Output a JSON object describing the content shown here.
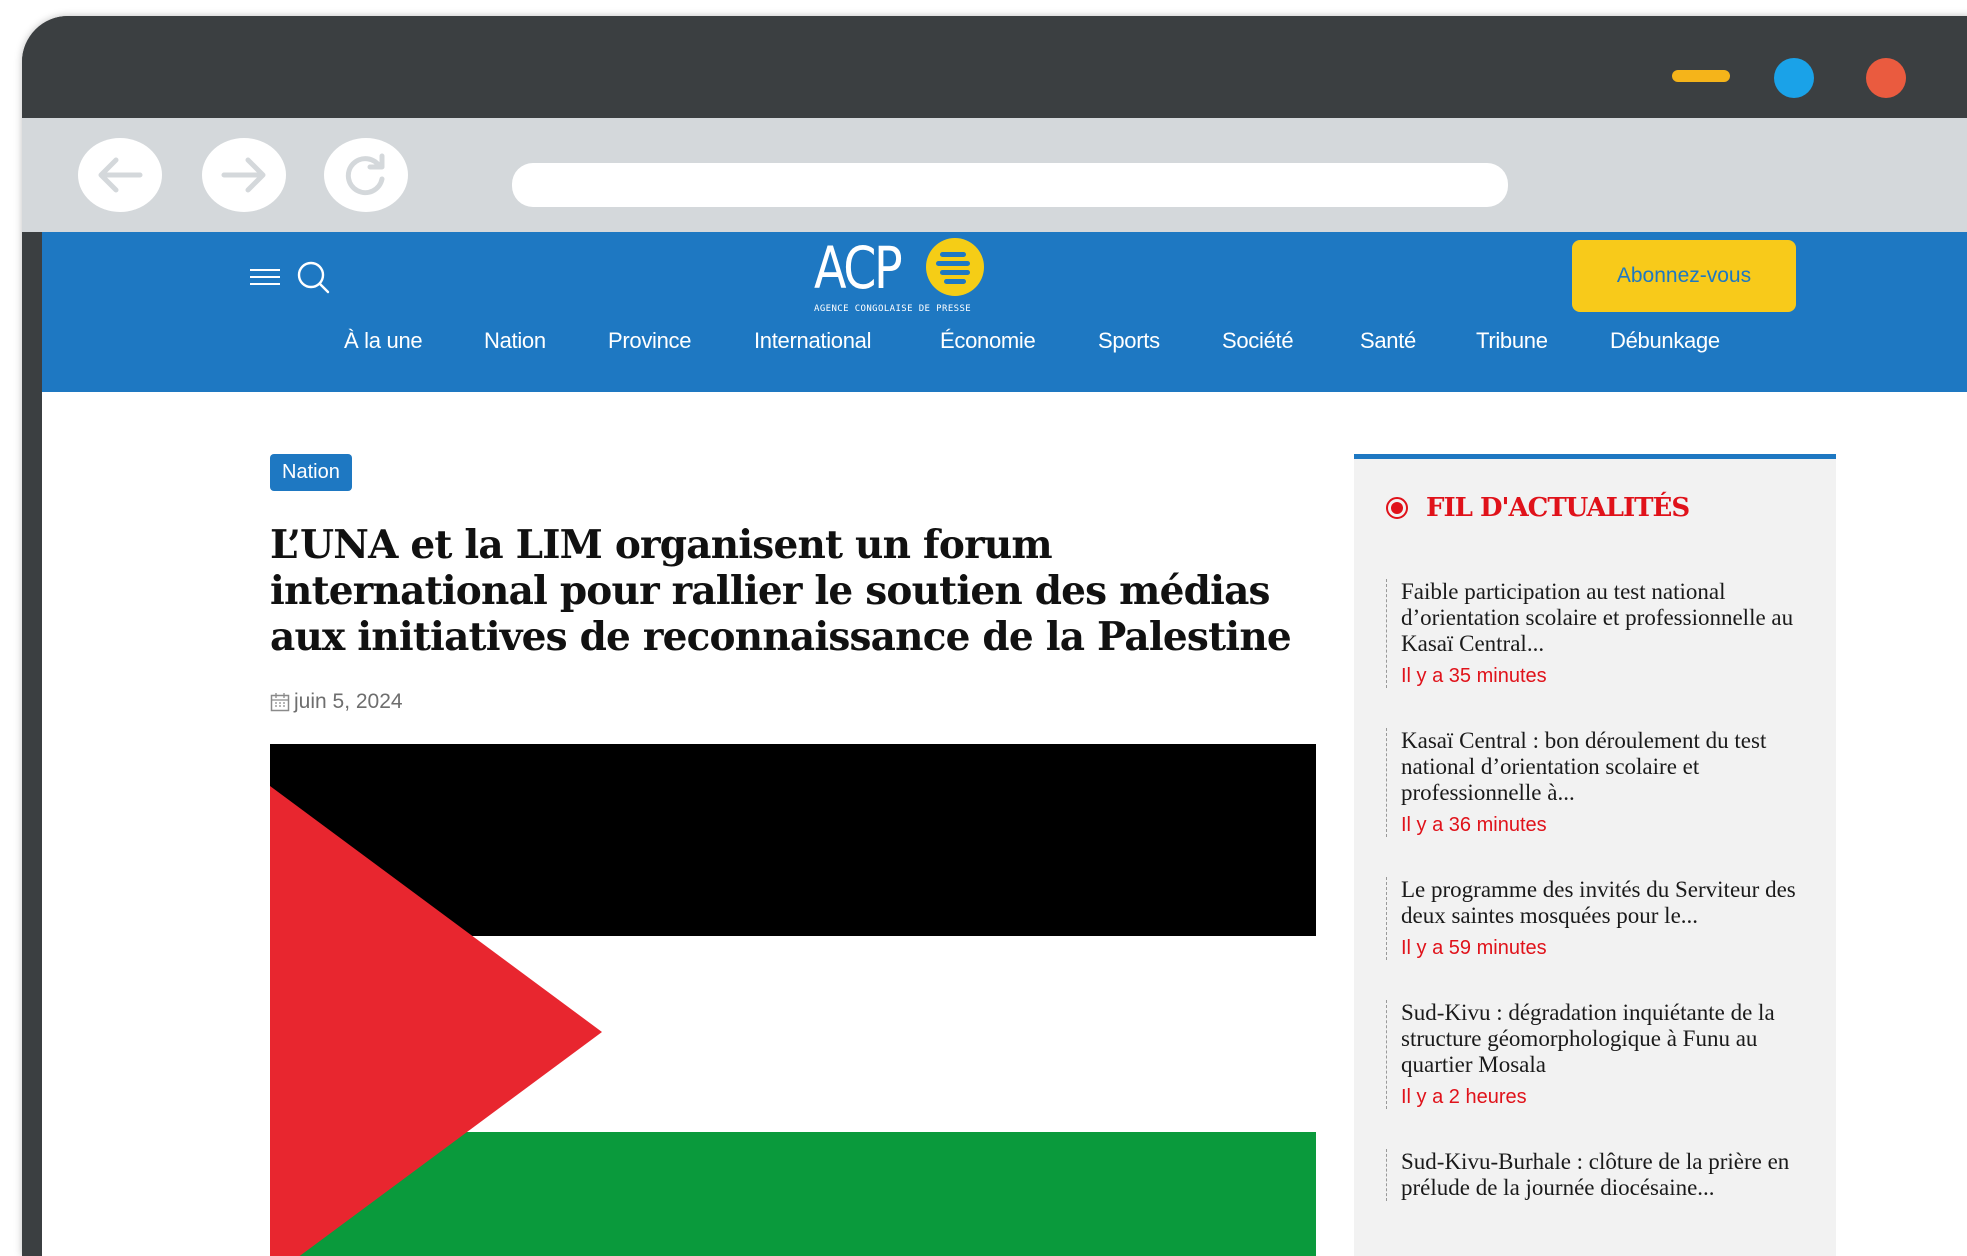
{
  "site": {
    "logo_text": "ACP",
    "logo_subtitle": "AGENCE CONGOLAISE DE PRESSE",
    "subscribe_label": "Abonnez-vous"
  },
  "nav": {
    "items": [
      "À la une",
      "Nation",
      "Province",
      "International",
      "Économie",
      "Sports",
      "Société",
      "Santé",
      "Tribune",
      "Débunkage"
    ]
  },
  "article": {
    "category": "Nation",
    "title": "L’UNA et la LIM organisent un forum international pour rallier le soutien des médias aux initiatives de reconnaissance de la Palestine",
    "date": "juin 5, 2024"
  },
  "feed": {
    "heading": "FIL D'ACTUALITÉS",
    "items": [
      {
        "title": "Faible participation au test national d’orientation scolaire et professionnelle au Kasaï Central...",
        "time": "Il y a 35 minutes"
      },
      {
        "title": "Kasaï Central : bon déroulement du test national d’orientation scolaire et professionnelle à...",
        "time": "Il y a 36 minutes"
      },
      {
        "title": "Le programme des invités du Serviteur des deux saintes mosquées pour le...",
        "time": "Il y a 59 minutes"
      },
      {
        "title": "Sud-Kivu : dégradation inquiétante de la structure géomorphologique à Funu au quartier Mosala",
        "time": "Il y a 2 heures"
      },
      {
        "title": "Sud-Kivu-Burhale : clôture de la prière en prélude de la journée diocésaine...",
        "time": ""
      }
    ]
  },
  "colors": {
    "brand_blue": "#1e78c2",
    "accent_yellow": "#f8ca1a",
    "alert_red": "#e0121a",
    "flag_black": "#000000",
    "flag_white": "#ffffff",
    "flag_green": "#0a9a3c",
    "flag_red": "#e8262f"
  },
  "icons": [
    "back-arrow-icon",
    "forward-arrow-icon",
    "reload-icon",
    "menu-icon",
    "search-icon",
    "calendar-icon",
    "live-dot-icon"
  ]
}
